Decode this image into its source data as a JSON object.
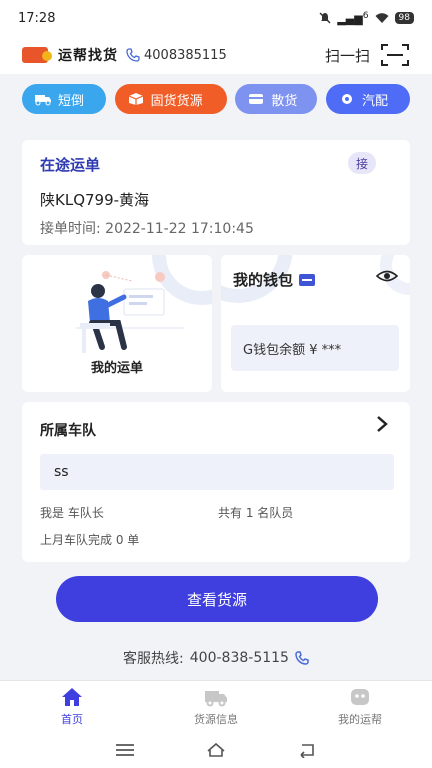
{
  "status": {
    "time": "17:28",
    "signal": "6",
    "battery": "98"
  },
  "header": {
    "app_name": "运帮找货",
    "phone": "4008385115",
    "scan_label": "扫一扫"
  },
  "chips": [
    {
      "label": "短倒",
      "icon": "truck-icon"
    },
    {
      "label": "固货货源",
      "icon": "box-icon"
    },
    {
      "label": "散货",
      "icon": "card-icon"
    },
    {
      "label": "汽配",
      "icon": "gear-icon"
    }
  ],
  "transit": {
    "title": "在途运单",
    "badge": "接",
    "plate": "陕KLQ799-黄海",
    "time_label": "接单时间:",
    "time_value": "2022-11-22 17:10:45"
  },
  "orders": {
    "label": "我的运单"
  },
  "wallet": {
    "title": "我的钱包",
    "balance": "G钱包余额 ¥ ***"
  },
  "fleet": {
    "title": "所属车队",
    "name": "ss",
    "role": "我是 车队长",
    "members": "共有 1 名队员",
    "last_month": "上月车队完成 0 单"
  },
  "cta": {
    "label": "查看货源"
  },
  "hotline": {
    "label": "客服热线:",
    "number": "400-838-5115"
  },
  "tabs": [
    {
      "label": "首页",
      "active": true
    },
    {
      "label": "货源信息",
      "active": false
    },
    {
      "label": "我的运帮",
      "active": false
    }
  ],
  "colors": {
    "primary": "#3f3fe0",
    "chip_blue": "#3aa6ee",
    "chip_orange": "#f15d27",
    "chip_lavender": "#7e92f0",
    "chip_indigo": "#4e6cf5"
  }
}
